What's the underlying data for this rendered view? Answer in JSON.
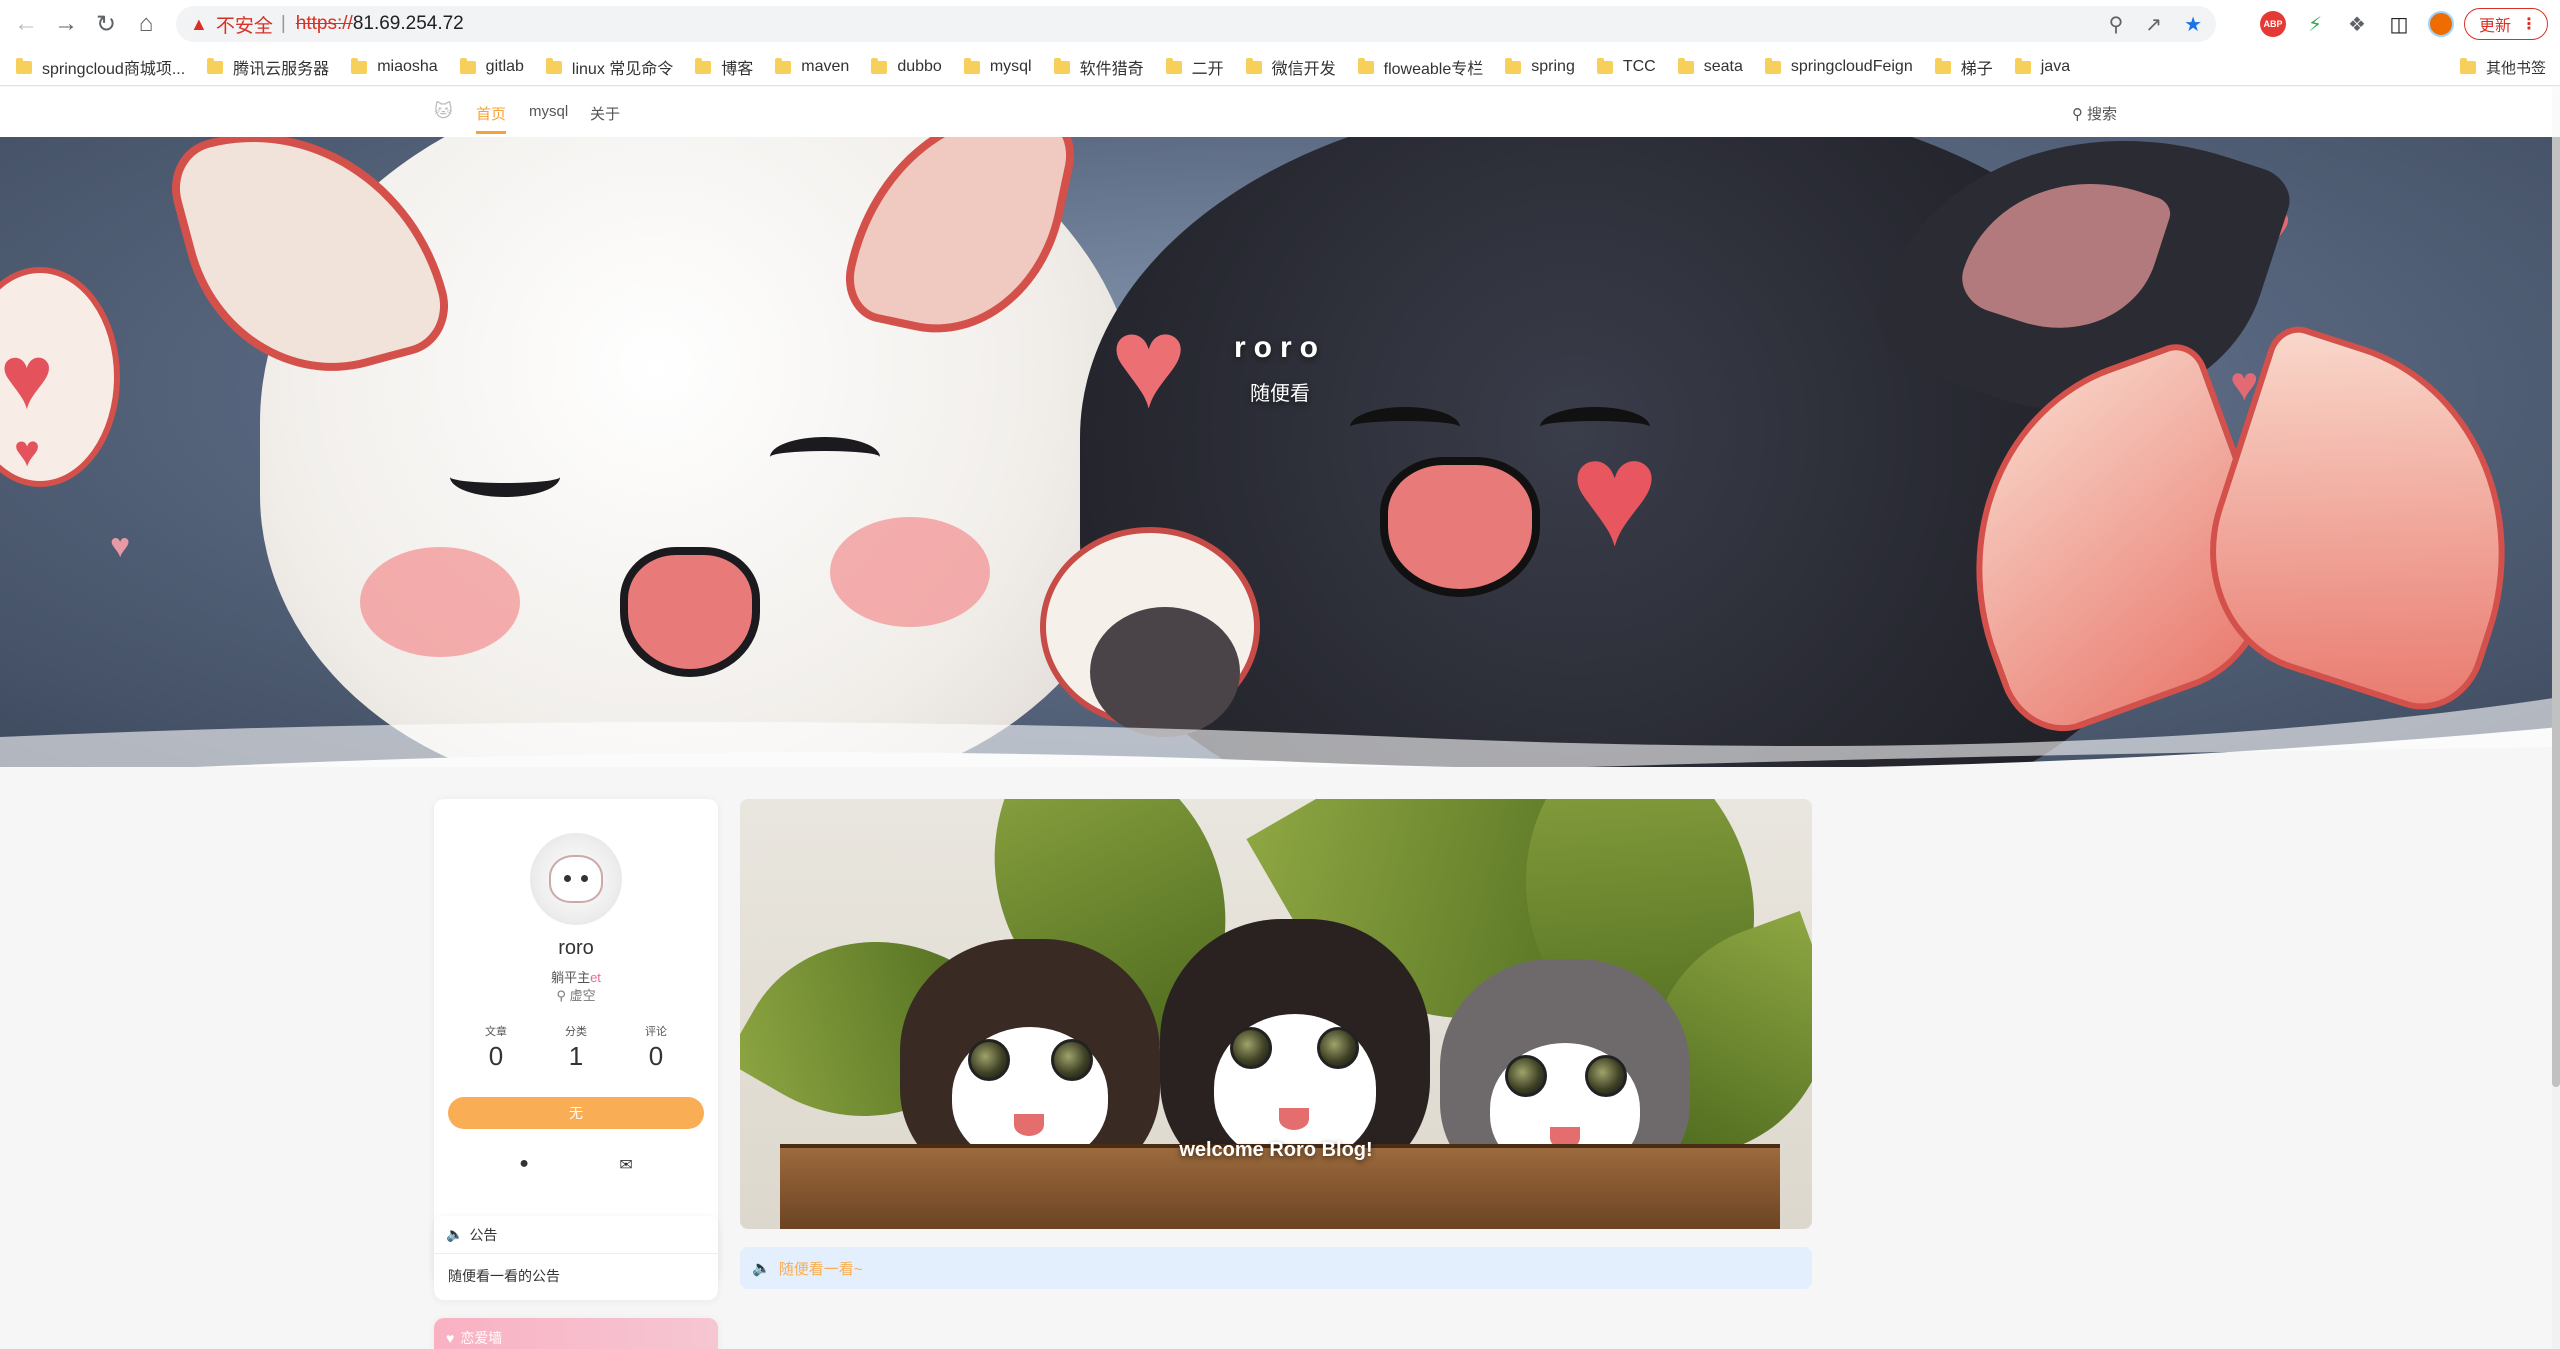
{
  "browser": {
    "security_label": "不安全",
    "url_scheme": "https://",
    "url_host": "81.69.254.72",
    "update_label": "更新",
    "extensions": {
      "abp": "ABP"
    },
    "bookmarks": [
      "springcloud商城项...",
      "腾讯云服务器",
      "miaosha",
      "gitlab",
      "linux 常见命令",
      "博客",
      "maven",
      "dubbo",
      "mysql",
      "软件猎奇",
      "二开",
      "微信开发",
      "floweable专栏",
      "spring",
      "TCC",
      "seata",
      "springcloudFeign",
      "梯子",
      "java"
    ],
    "other_bookmarks": "其他书签"
  },
  "site_nav": {
    "items": [
      "首页",
      "mysql",
      "关于"
    ],
    "search": "搜索"
  },
  "hero": {
    "title": "roro",
    "subtitle": "随便看"
  },
  "profile": {
    "name": "roro",
    "tag_main": "躺平主",
    "tag_suffix": "et",
    "location": "虚空",
    "stats": [
      {
        "label": "文章",
        "value": "0"
      },
      {
        "label": "分类",
        "value": "1"
      },
      {
        "label": "评论",
        "value": "0"
      }
    ],
    "button": "无"
  },
  "notice": {
    "title": "公告",
    "body": "随便看一看的公告"
  },
  "pink_card": {
    "title": "恋爱墙"
  },
  "banner": {
    "text": "welcome Roro Blog!"
  },
  "ticker": {
    "text": "随便看一看~"
  },
  "colors": {
    "accent": "#f9ad54",
    "insecure": "#d93025",
    "ticker_bg": "#e3effd"
  }
}
